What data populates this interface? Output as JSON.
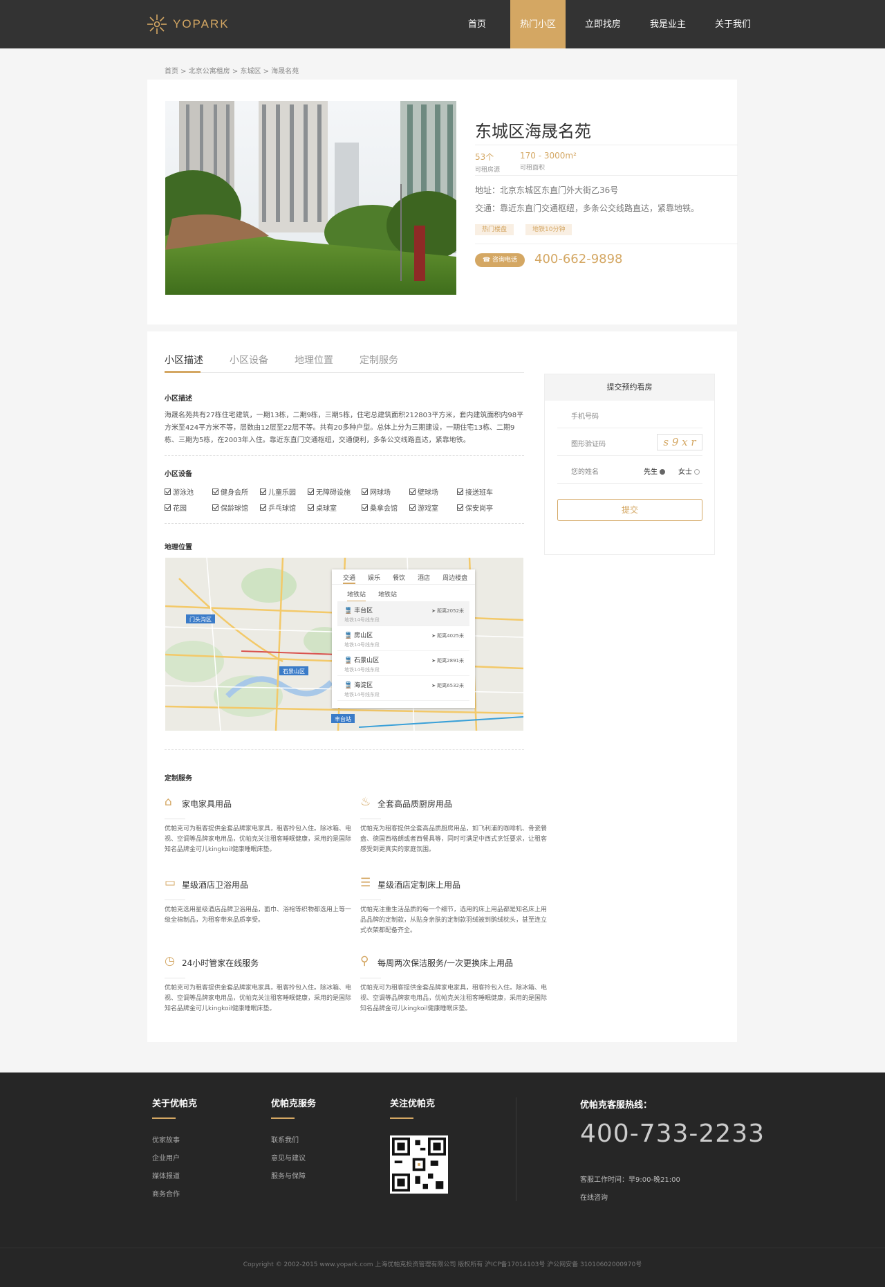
{
  "header": {
    "logo_text": "YOPARK",
    "nav": [
      {
        "label": "首页",
        "active": false
      },
      {
        "label": "热门小区",
        "active": true
      },
      {
        "label": "立即找房",
        "active": false
      },
      {
        "label": "我是业主",
        "active": false
      },
      {
        "label": "关于我们",
        "active": false
      }
    ]
  },
  "breadcrumb": "首页 > 北京公寓租房 > 东城区 > 海晟名苑",
  "property": {
    "title": "东城区海晟名苑",
    "units_value": "53个",
    "units_label": "可租房源",
    "area_value": "170 - 3000m²",
    "area_label": "可租面积",
    "address": "地址：北京东城区东直门外大街乙36号",
    "traffic": "交通：靠近东直门交通枢纽，多条公交线路直达，紧靠地铁。",
    "tags": [
      "热门楼盘",
      "地铁10分钟"
    ],
    "call_label": "咨询电话",
    "phone": "400-662-9898"
  },
  "tabs": [
    {
      "label": "小区描述",
      "active": true
    },
    {
      "label": "小区设备",
      "active": false
    },
    {
      "label": "地理位置",
      "active": false
    },
    {
      "label": "定制服务",
      "active": false
    }
  ],
  "description": {
    "heading": "小区描述",
    "text": "海晟名苑共有27栋住宅建筑，一期13栋，二期9栋，三期5栋，住宅总建筑面积212803平方米，套内建筑面积内98平方米至424平方米不等，层数由12层至22层不等。共有20多种户型。总体上分为三期建设，一期住宅13栋、二期9栋、三期为5栋，在2003年入住。靠近东直门交通枢纽，交通便利，多条公交线路直达，紧靠地铁。"
  },
  "facilities": {
    "heading": "小区设备",
    "row1": [
      "游泳池",
      "健身会所",
      "儿童乐园",
      "无障碍设施",
      "网球场",
      "壁球场",
      "接送班车"
    ],
    "row2": [
      "花园",
      "保龄球馆",
      "乒乓球馆",
      "桌球室",
      "桑拿会馆",
      "游戏室",
      "保安岗亭"
    ]
  },
  "location": {
    "heading": "地理位置",
    "map_labels": [
      "门头沟区",
      "石景山区",
      "丰台站"
    ],
    "tabs": [
      "交通",
      "娱乐",
      "餐饮",
      "酒店",
      "周边楼盘"
    ],
    "subtabs": [
      "地铁站",
      "地铁站"
    ],
    "stations": [
      {
        "name": "丰台区",
        "line": "地铁14号线东段",
        "distance": "距离2052米"
      },
      {
        "name": "房山区",
        "line": "地铁14号线东段",
        "distance": "距离4025米"
      },
      {
        "name": "石景山区",
        "line": "地铁14号线东段",
        "distance": "距离2891米"
      },
      {
        "name": "海淀区",
        "line": "地铁14号线东段",
        "distance": "距离6532米"
      }
    ]
  },
  "services": {
    "heading": "定制服务",
    "items": [
      {
        "icon": "house-icon",
        "title": "家电家具用品",
        "text": "优帕克可为租客提供金套品牌家电家具，租客拎包入住。除冰箱、电视、空调等品牌家电用品，优帕克关注租客睡眠健康，采用的是国际知名品牌金可儿kingkoil健康睡眠床垫。"
      },
      {
        "icon": "kitchen-icon",
        "title": "全套高品质厨房用品",
        "text": "优帕克为租客提供全套高品质厨房用品，如飞利浦的咖啡机、骨瓷餐盘、德国西格朗或者西餐具等，同时可满足中西式烹饪要求，让租客感受到更真实的家庭氛围。"
      },
      {
        "icon": "bath-icon",
        "title": "星级酒店卫浴用品",
        "text": "优帕克选用星级酒店品牌卫浴用品，面巾、浴袍等织物都选用上等一级全棉制品，为租客带来品质享受。"
      },
      {
        "icon": "bed-icon",
        "title": "星级酒店定制床上用品",
        "text": "优帕克注重生活品质的每一个细节，选用的床上用品都是知名床上用品品牌的定制款，从贴身亲肤的定制款羽绒被到鹅绒枕头，甚至连立式衣架都配备齐全。"
      },
      {
        "icon": "clock-icon",
        "title": "24小时管家在线服务",
        "text": "优帕克可为租客提供金套品牌家电家具，租客拎包入住。除冰箱、电视、空调等品牌家电用品，优帕克关注租客睡眠健康，采用的是国际知名品牌金可儿kingkoil健康睡眠床垫。"
      },
      {
        "icon": "cleaning-icon",
        "title": "每周两次保洁服务/一次更换床上用品",
        "text": "优帕克可为租客提供金套品牌家电家具，租客拎包入住。除冰箱、电视、空调等品牌家电用品，优帕克关注租客睡眠健康，采用的是国际知名品牌金可儿kingkoil健康睡眠床垫。"
      }
    ]
  },
  "form": {
    "title": "提交预约看房",
    "phone_placeholder": "手机号码",
    "captcha_label": "图形验证码",
    "captcha_text": "s 9 x r",
    "name_label": "您的姓名",
    "male": "先生",
    "female": "女士",
    "submit": "提交"
  },
  "footer": {
    "col1": {
      "title": "关于优帕克",
      "links": [
        "优家故事",
        "企业用户",
        "媒体报道",
        "商务合作"
      ]
    },
    "col2": {
      "title": "优帕克服务",
      "links": [
        "联系我们",
        "意见与建议",
        "服务与保障"
      ]
    },
    "col3": {
      "title": "关注优帕克"
    },
    "hotline_title": "优帕克客服热线：",
    "hotline": "400-733-2233",
    "hours": "客服工作时间：早9:00-晚21:00",
    "online": "在线咨询",
    "copyright": "Copyright © 2002-2015 www.yopark.com 上海优帕克投资管理有限公司 版权所有 沪ICP备17014103号 沪公网安备 31010602000970号"
  },
  "colors": {
    "accent": "#d4a763",
    "header_bg": "#333333",
    "footer_bg": "#262626"
  }
}
